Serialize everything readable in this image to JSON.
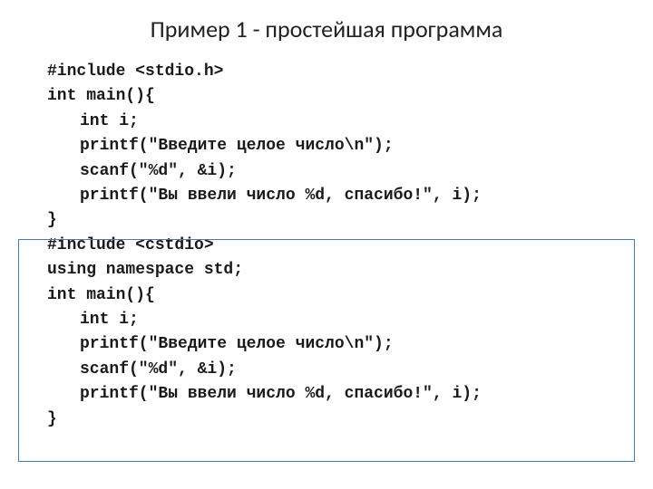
{
  "title": "Пример 1 - простейшая программа",
  "code1": {
    "l0": "#include <stdio.h>",
    "l1": "int main(){",
    "l2": "int i;",
    "l3": "printf(\"Введите целое число\\n\");",
    "l4": "scanf(\"%d\", &i);",
    "l5": "printf(\"Вы ввели число %d, спасибо!\", i);",
    "l6": "}"
  },
  "code2": {
    "l0": "#include <cstdio>",
    "l1": "using namespace std;",
    "l2": "int main(){",
    "l3": "int i;",
    "l4": "printf(\"Введите целое число\\n\");",
    "l5": "scanf(\"%d\", &i);",
    "l6": "printf(\"Вы ввели число %d, спасибо!\", i);",
    "l7": "}"
  }
}
